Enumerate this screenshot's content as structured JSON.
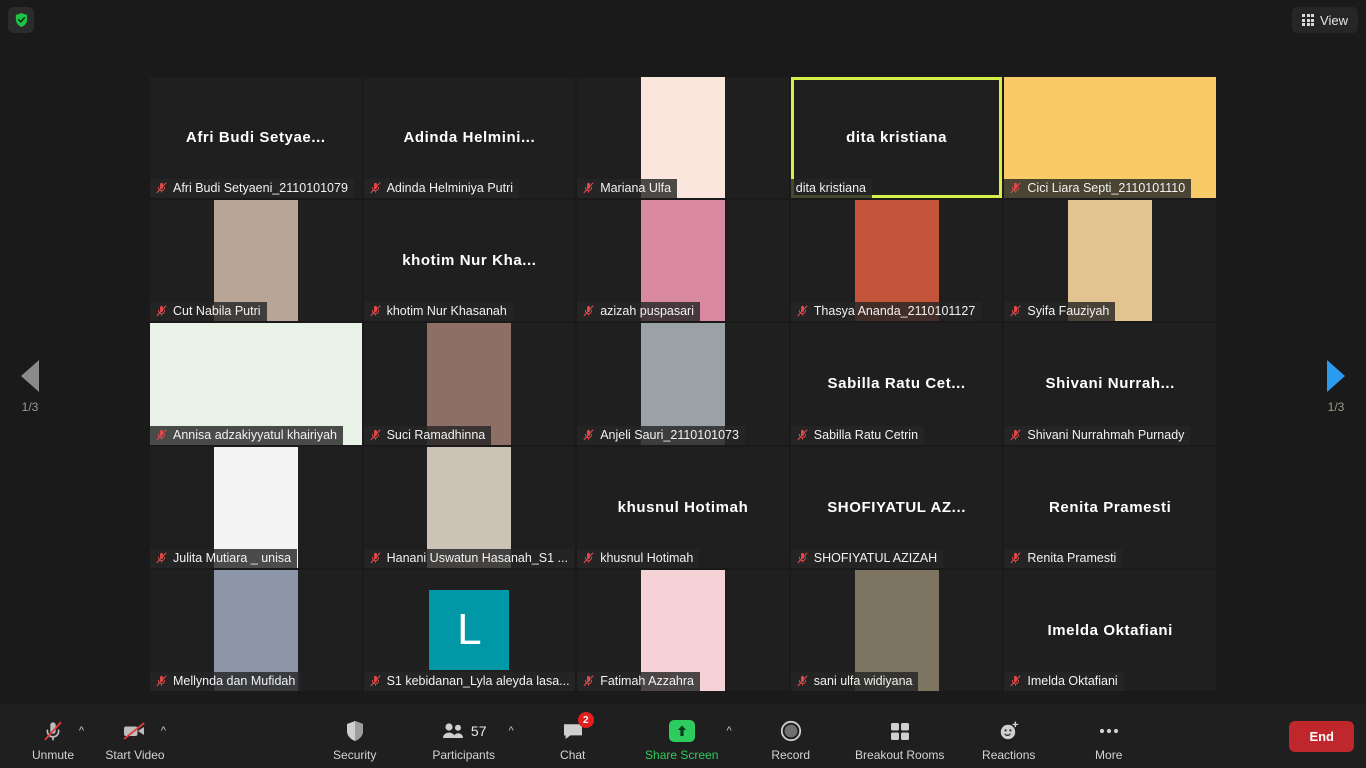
{
  "topbar": {
    "shield_icon": "shield-check-icon",
    "view_label": "View",
    "view_icon": "grid-icon"
  },
  "pager": {
    "left_icon": "chevron-left-icon",
    "right_icon": "chevron-right-icon",
    "left_page": "1/3",
    "right_page": "1/3"
  },
  "gallery": {
    "tiles": [
      {
        "name": "Afri Budi Setyaeni_2110101079",
        "display": "Afri Budi Setyae...",
        "kind": "name",
        "muted": true,
        "active": false
      },
      {
        "name": "Adinda Helminiya Putri",
        "display": "Adinda  Helmini...",
        "kind": "name",
        "muted": true,
        "active": false
      },
      {
        "name": "Mariana Ulfa",
        "display": "",
        "kind": "photo",
        "muted": true,
        "active": false,
        "bg": "#fbe6dd"
      },
      {
        "name": "dita kristiana",
        "display": "dita kristiana",
        "kind": "name",
        "muted": false,
        "active": true
      },
      {
        "name": "Cici Liara Septi_2110101110",
        "display": "",
        "kind": "video",
        "muted": true,
        "active": false,
        "bg": "#f9cb68"
      },
      {
        "name": "Cut Nabila Putri",
        "display": "",
        "kind": "photo",
        "muted": true,
        "active": false,
        "bg": "#b9a596"
      },
      {
        "name": "khotim Nur Khasanah",
        "display": "khotim  Nur Kha...",
        "kind": "name",
        "muted": true,
        "active": false
      },
      {
        "name": "azizah puspasari",
        "display": "",
        "kind": "photo",
        "muted": true,
        "active": false,
        "bg": "#d98aa0"
      },
      {
        "name": "Thasya Ananda_2110101127",
        "display": "",
        "kind": "photo",
        "muted": true,
        "active": false,
        "bg": "#c4553a"
      },
      {
        "name": "Syifa Fauziyah",
        "display": "",
        "kind": "photo",
        "muted": true,
        "active": false,
        "bg": "#e3c38f"
      },
      {
        "name": "Annisa adzakiyyatul khairiyah",
        "display": "",
        "kind": "video",
        "muted": true,
        "active": false,
        "bg": "#e9f2e6"
      },
      {
        "name": "Suci Ramadhinna",
        "display": "",
        "kind": "photo",
        "muted": true,
        "active": false,
        "bg": "#8d6f66"
      },
      {
        "name": "Anjeli Sauri_2110101073",
        "display": "",
        "kind": "photo",
        "muted": true,
        "active": false,
        "bg": "#9aa2a8"
      },
      {
        "name": "Sabilla Ratu Cetrin",
        "display": "Sabilla  Ratu  Cet...",
        "kind": "name",
        "muted": true,
        "active": false
      },
      {
        "name": "Shivani Nurrahmah Purnady",
        "display": "Shivani  Nurrah...",
        "kind": "name",
        "muted": true,
        "active": false
      },
      {
        "name": "Julita Mutiara _ unisa",
        "display": "",
        "kind": "photo",
        "muted": true,
        "active": false,
        "bg": "#f4f4f4"
      },
      {
        "name": "Hanani Uswatun Hasanah_S1 ...",
        "display": "",
        "kind": "photo",
        "muted": true,
        "active": false,
        "bg": "#ccc3b6"
      },
      {
        "name": "khusnul Hotimah",
        "display": "khusnul Hotimah",
        "kind": "name",
        "muted": true,
        "active": false
      },
      {
        "name": "SHOFIYATUL AZIZAH",
        "display": "SHOFIYATUL  AZ...",
        "kind": "name",
        "muted": true,
        "active": false
      },
      {
        "name": "Renita Pramesti",
        "display": "Renita Pramesti",
        "kind": "name",
        "muted": true,
        "active": false
      },
      {
        "name": "Mellynda dan Mufidah",
        "display": "",
        "kind": "photo",
        "muted": true,
        "active": false,
        "bg": "#8d96a8"
      },
      {
        "name": "S1 kebidanan_Lyla aleyda lasa...",
        "display": "L",
        "kind": "letter",
        "muted": true,
        "active": false,
        "bg": "#0097a7"
      },
      {
        "name": "Fatimah Azzahra",
        "display": "",
        "kind": "photo",
        "muted": true,
        "active": false,
        "bg": "#f5d2d6"
      },
      {
        "name": "sani ulfa widiyana",
        "display": "",
        "kind": "photo",
        "muted": true,
        "active": false,
        "bg": "#7d7462"
      },
      {
        "name": "Imelda Oktafiani",
        "display": "Imelda Oktafiani",
        "kind": "name",
        "muted": true,
        "active": false
      }
    ]
  },
  "toolbar": {
    "unmute": {
      "label": "Unmute",
      "icon": "mic-off-icon",
      "caret": "audio-options-caret"
    },
    "start_video": {
      "label": "Start Video",
      "icon": "video-off-icon",
      "caret": "video-options-caret"
    },
    "security": {
      "label": "Security",
      "icon": "shield-icon"
    },
    "participants": {
      "label": "Participants",
      "icon": "participants-icon",
      "count": "57",
      "caret": "participants-caret"
    },
    "chat": {
      "label": "Chat",
      "icon": "chat-icon",
      "badge": "2"
    },
    "share_screen": {
      "label": "Share Screen",
      "icon": "share-screen-icon",
      "caret": "share-options-caret"
    },
    "record": {
      "label": "Record",
      "icon": "record-icon"
    },
    "breakout_rooms": {
      "label": "Breakout Rooms",
      "icon": "breakout-rooms-icon"
    },
    "reactions": {
      "label": "Reactions",
      "icon": "reactions-icon"
    },
    "more": {
      "label": "More",
      "icon": "more-icon"
    },
    "end": {
      "label": "End"
    }
  },
  "colors": {
    "active_speaker_border": "#d8ef4a",
    "end_button": "#c0272d",
    "share_green": "#2ecc5f",
    "pager_active": "#2d9cf0",
    "chat_badge": "#e02020"
  }
}
